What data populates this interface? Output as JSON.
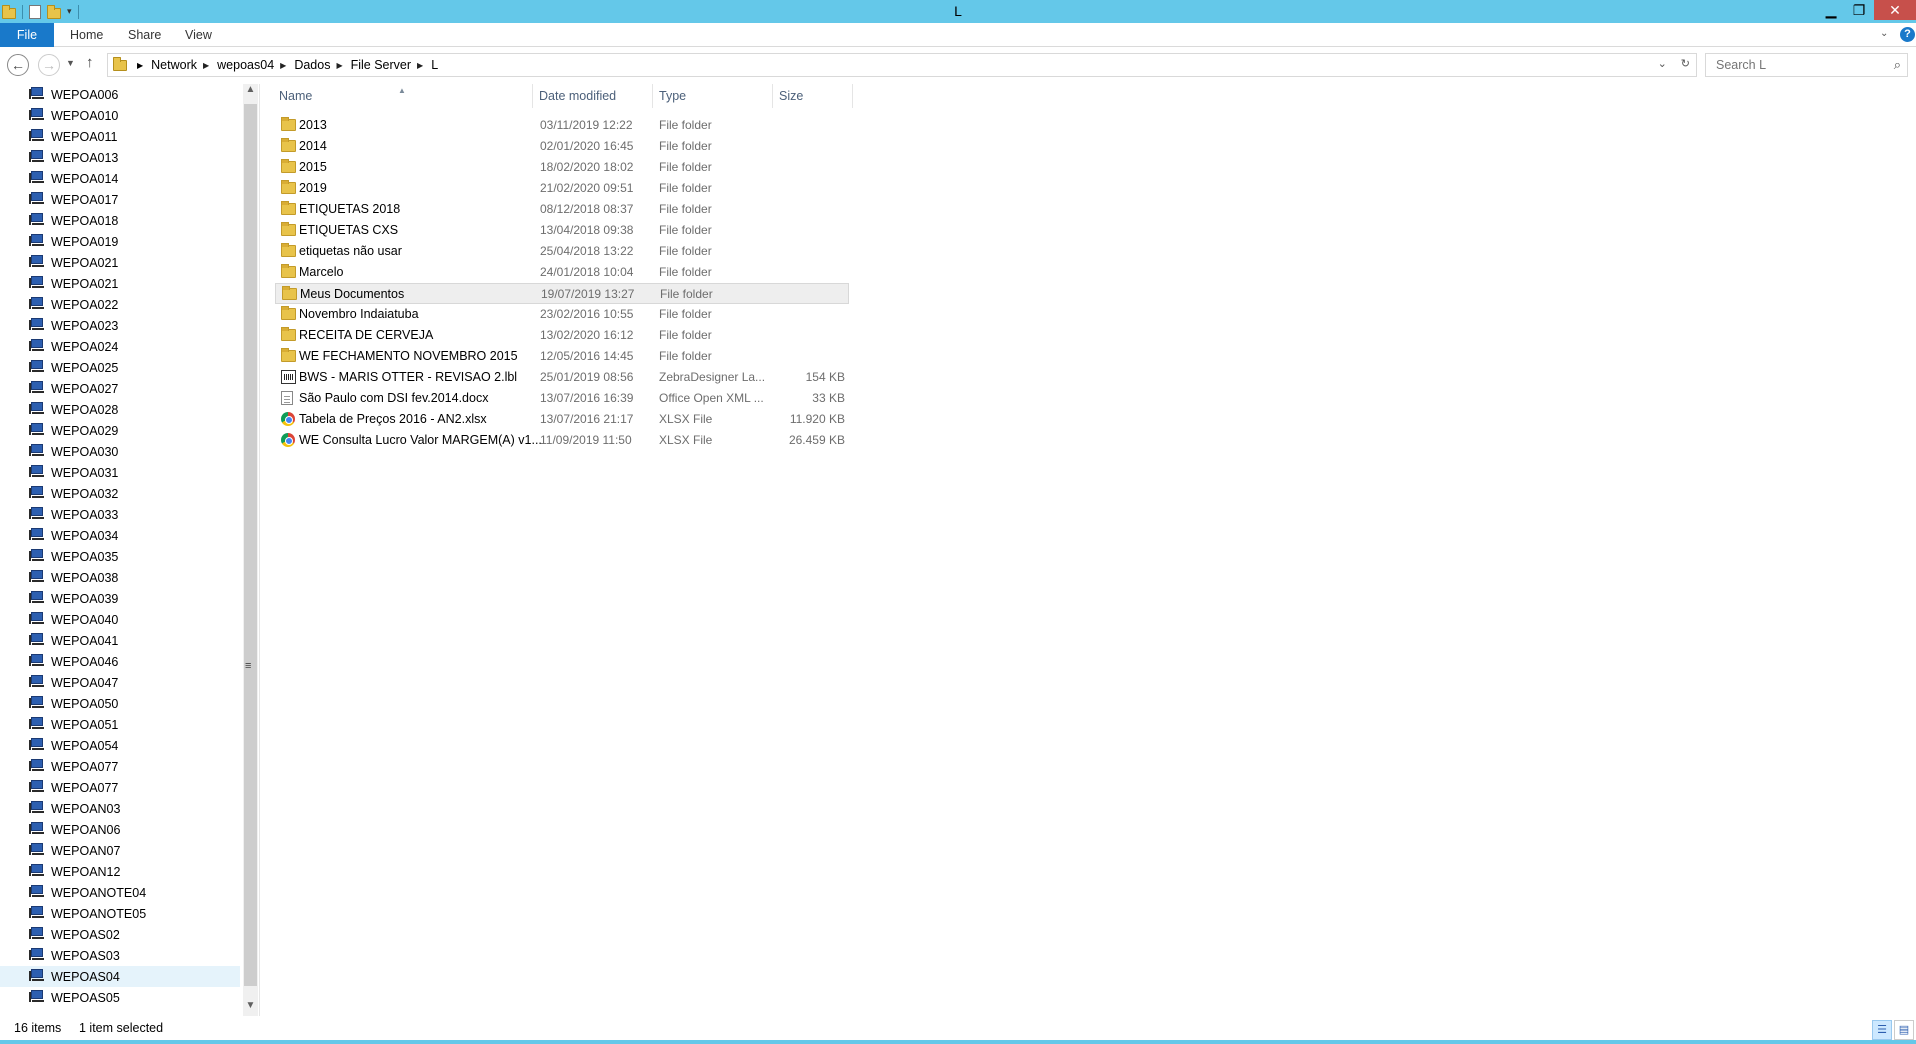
{
  "window": {
    "title": "L"
  },
  "ribbon": {
    "tabs": [
      "File",
      "Home",
      "Share",
      "View"
    ]
  },
  "address": {
    "crumbs": [
      "Network",
      "wepoas04",
      "Dados",
      "File Server",
      "L"
    ],
    "search_placeholder": "Search L"
  },
  "nav_pane": {
    "items": [
      "WEPOA006",
      "WEPOA010",
      "WEPOA011",
      "WEPOA013",
      "WEPOA014",
      "WEPOA017",
      "WEPOA018",
      "WEPOA019",
      "WEPOA021",
      "WEPOA021",
      "WEPOA022",
      "WEPOA023",
      "WEPOA024",
      "WEPOA025",
      "WEPOA027",
      "WEPOA028",
      "WEPOA029",
      "WEPOA030",
      "WEPOA031",
      "WEPOA032",
      "WEPOA033",
      "WEPOA034",
      "WEPOA035",
      "WEPOA038",
      "WEPOA039",
      "WEPOA040",
      "WEPOA041",
      "WEPOA046",
      "WEPOA047",
      "WEPOA050",
      "WEPOA051",
      "WEPOA054",
      "WEPOA077",
      "WEPOA077",
      "WEPOAN03",
      "WEPOAN06",
      "WEPOAN07",
      "WEPOAN12",
      "WEPOANOTE04",
      "WEPOANOTE05",
      "WEPOAS02",
      "WEPOAS03",
      "WEPOAS04",
      "WEPOAS05"
    ],
    "selected": "WEPOAS04"
  },
  "columns": {
    "name": "Name",
    "date": "Date modified",
    "type": "Type",
    "size": "Size"
  },
  "files": [
    {
      "name": "2013",
      "date": "03/11/2019 12:22",
      "type": "File folder",
      "size": "",
      "icon": "folder-icon"
    },
    {
      "name": "2014",
      "date": "02/01/2020 16:45",
      "type": "File folder",
      "size": "",
      "icon": "folder-icon"
    },
    {
      "name": "2015",
      "date": "18/02/2020 18:02",
      "type": "File folder",
      "size": "",
      "icon": "folder-icon"
    },
    {
      "name": "2019",
      "date": "21/02/2020 09:51",
      "type": "File folder",
      "size": "",
      "icon": "folder-icon"
    },
    {
      "name": "ETIQUETAS 2018",
      "date": "08/12/2018 08:37",
      "type": "File folder",
      "size": "",
      "icon": "folder-icon"
    },
    {
      "name": "ETIQUETAS CXS",
      "date": "13/04/2018 09:38",
      "type": "File folder",
      "size": "",
      "icon": "folder-icon"
    },
    {
      "name": "etiquetas não usar",
      "date": "25/04/2018 13:22",
      "type": "File folder",
      "size": "",
      "icon": "folder-icon"
    },
    {
      "name": "Marcelo",
      "date": "24/01/2018 10:04",
      "type": "File folder",
      "size": "",
      "icon": "folder-icon"
    },
    {
      "name": "Meus Documentos",
      "date": "19/07/2019 13:27",
      "type": "File folder",
      "size": "",
      "icon": "folder-icon"
    },
    {
      "name": "Novembro Indaiatuba",
      "date": "23/02/2016 10:55",
      "type": "File folder",
      "size": "",
      "icon": "folder-icon"
    },
    {
      "name": "RECEITA DE CERVEJA",
      "date": "13/02/2020 16:12",
      "type": "File folder",
      "size": "",
      "icon": "folder-icon"
    },
    {
      "name": "WE FECHAMENTO NOVEMBRO 2015",
      "date": "12/05/2016 14:45",
      "type": "File folder",
      "size": "",
      "icon": "folder-icon"
    },
    {
      "name": "BWS - MARIS OTTER - REVISAO 2.lbl",
      "date": "25/01/2019 08:56",
      "type": "ZebraDesigner La...",
      "size": "154 KB",
      "icon": "label-file-icon"
    },
    {
      "name": "São Paulo com DSI fev.2014.docx",
      "date": "13/07/2016 16:39",
      "type": "Office Open XML ...",
      "size": "33 KB",
      "icon": "document-icon"
    },
    {
      "name": "Tabela de Preços 2016 - AN2.xlsx",
      "date": "13/07/2016 21:17",
      "type": "XLSX File",
      "size": "11.920 KB",
      "icon": "chrome-icon"
    },
    {
      "name": "WE Consulta Lucro Valor MARGEM(A) v1...",
      "date": "11/09/2019 11:50",
      "type": "XLSX File",
      "size": "26.459 KB",
      "icon": "chrome-icon"
    }
  ],
  "highlighted_row": "Meus Documentos",
  "status": {
    "items": "16 items",
    "selection": "1 item selected"
  },
  "colors": {
    "titlebar": "#64c8e9",
    "file_tab": "#1979ca",
    "close": "#c7504b"
  }
}
